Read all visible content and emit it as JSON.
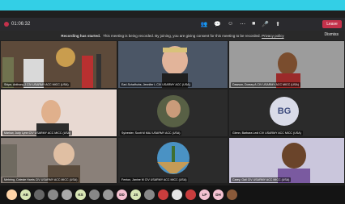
{
  "meeting": {
    "timer": "01:06:32",
    "leave_label": "Leave"
  },
  "recording": {
    "title": "Recording has started.",
    "message": "This meeting is being recorded. By joining, you are giving consent for this meeting to be recorded.",
    "privacy": "Privacy policy",
    "dismiss_label": "Dismiss"
  },
  "participants": [
    {
      "name": "Shipe, Anthony J CIV USARMY ACC MICC (USA)"
    },
    {
      "name": "Earl-Schafhuhs, Jennifer L CIV USARMY ACC (USA)"
    },
    {
      "name": "Dawson, Dorsey A CIV USARMY ACC MICC (USA)"
    },
    {
      "name": "Marlow, Judy Lynn CIV USARMY ACC MICC (USA)"
    },
    {
      "name": "Sylvester, Scott M MAJ USARMY ACC (USA)"
    },
    {
      "name": "Glenn, Barbara Ledi CIV USARMY ACC MICC (USA)"
    },
    {
      "name": "Mehring, Celeste Harris CIV USARMY ACC MICC (USA)"
    },
    {
      "name": "Fenton, Janine M CIV USARMY ACC MICC (USA)"
    },
    {
      "name": "Carey, Gail CIV USARMY ACC MICC (USA)"
    }
  ],
  "avatar_initials": "BG",
  "tray": [
    "AB",
    "",
    "",
    "",
    "KS",
    "",
    "",
    "DD",
    "JS",
    "",
    "",
    "",
    "",
    "LP",
    "DH",
    ""
  ]
}
